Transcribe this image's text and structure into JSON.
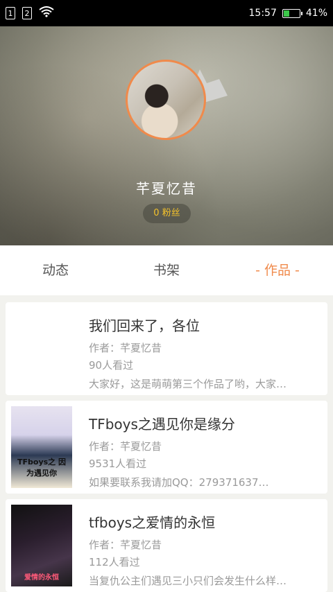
{
  "statusbar": {
    "sim1": "1",
    "sim2": "2",
    "time": "15:57",
    "battery_text": "41%",
    "battery_level": 0.41
  },
  "profile": {
    "username": "芊夏忆昔",
    "fans_label": "0 粉丝"
  },
  "tabs": [
    {
      "label": "动态"
    },
    {
      "label": "书架"
    },
    {
      "label": "作品"
    }
  ],
  "works": [
    {
      "title": "我们回来了，各位",
      "author": "作者：芊夏忆昔",
      "views": "90人看过",
      "desc": "大家好，这是萌萌第三个作品了哟，大家…"
    },
    {
      "title": "TFboys之遇见你是缘分",
      "author": "作者：芊夏忆昔",
      "views": "9531人看过",
      "desc": "如果要联系我请加QQ：279371637…",
      "cover_text": "TFboys之 因为遇见你"
    },
    {
      "title": "tfboys之爱情的永恒",
      "author": "作者：芊夏忆昔",
      "views": "112人看过",
      "desc": "当复仇公主们遇见三小只们会发生什么样…",
      "cover_text": "爱情的永恒"
    }
  ],
  "colors": {
    "accent": "#f08a4b",
    "fans_text": "#f5c32b",
    "battery": "#3cc84a"
  }
}
